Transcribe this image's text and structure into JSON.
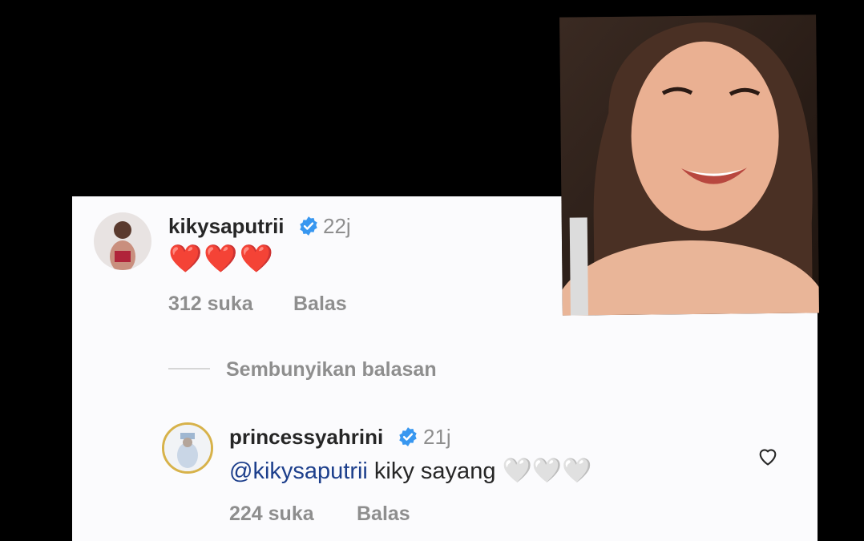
{
  "comment": {
    "username": "kikysaputrii",
    "time": "22j",
    "hearts": "❤️❤️❤️",
    "likes": "312 suka",
    "reply_label": "Balas"
  },
  "hide_replies_label": "Sembunyikan balasan",
  "reply": {
    "username": "princessyahrini",
    "time": "21j",
    "mention": "@kikysaputrii",
    "text": " kiky sayang ",
    "hearts": "🤍🤍🤍",
    "likes": "224 suka",
    "reply_label": "Balas"
  },
  "colors": {
    "background": "#000000",
    "panel": "#fbfbfd",
    "verified": "#3897f0",
    "mention": "#1d3f8c",
    "muted": "#8e8e8e"
  },
  "icons": [
    "verified-badge-icon",
    "heart-outline-icon"
  ]
}
